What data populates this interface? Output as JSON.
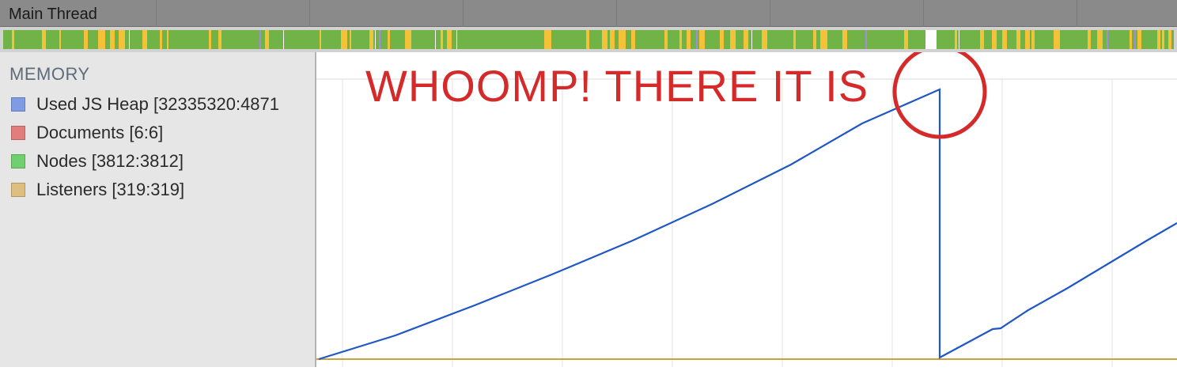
{
  "header": {
    "title": "Main Thread"
  },
  "memory": {
    "title": "MEMORY",
    "legend": [
      {
        "label": "Used JS Heap [32335320:4871",
        "color": "#7f9be3"
      },
      {
        "label": "Documents [6:6]",
        "color": "#e27d7d"
      },
      {
        "label": "Nodes [3812:3812]",
        "color": "#70d070"
      },
      {
        "label": "Listeners [319:319]",
        "color": "#dfbf7e"
      }
    ]
  },
  "annotation": {
    "text": "WHOOMP! THERE IT IS",
    "color": "#d42a2a"
  },
  "colors": {
    "heap_line": "#1f57c4",
    "listeners_line": "#c8a23c",
    "activity_green": "#72b347",
    "activity_yellow": "#f3c238",
    "activity_purple": "#a48ae0"
  }
}
